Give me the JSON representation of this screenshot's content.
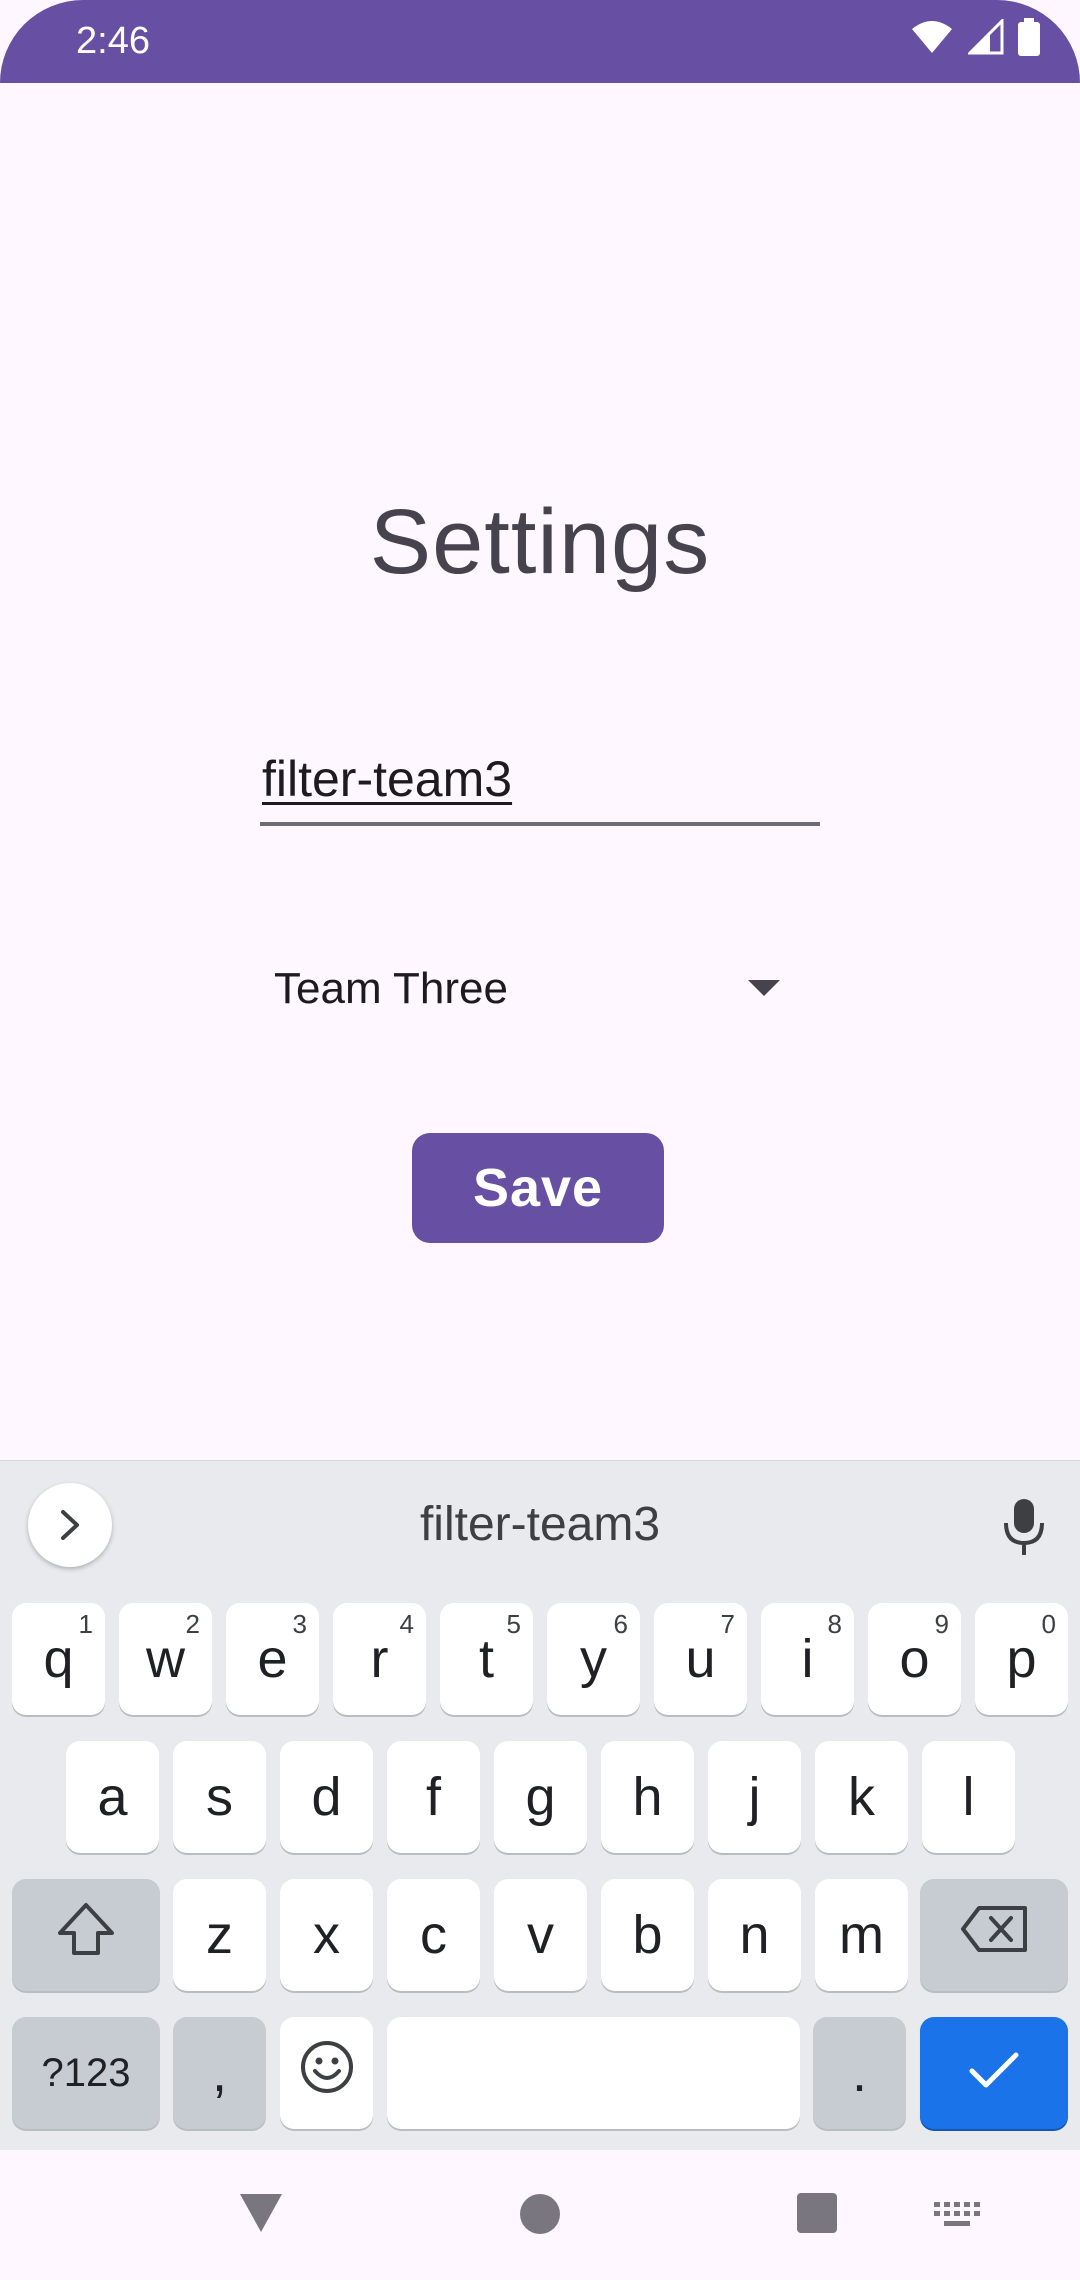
{
  "status_bar": {
    "time": "2:46",
    "icons": [
      "wifi-icon",
      "signal-icon",
      "battery-icon"
    ],
    "color": "#6750a4"
  },
  "screen": {
    "title": "Settings",
    "filter_field": {
      "value": "filter-team3"
    },
    "team_dropdown": {
      "selected": "Team Three",
      "icon": "dropdown-arrow-icon"
    },
    "save_label": "Save",
    "accent_color": "#6750a4"
  },
  "keyboard": {
    "suggestion": "filter-team3",
    "expand_icon": "chevron-right-icon",
    "mic_icon": "mic-icon",
    "row1": [
      {
        "k": "q",
        "h": "1"
      },
      {
        "k": "w",
        "h": "2"
      },
      {
        "k": "e",
        "h": "3"
      },
      {
        "k": "r",
        "h": "4"
      },
      {
        "k": "t",
        "h": "5"
      },
      {
        "k": "y",
        "h": "6"
      },
      {
        "k": "u",
        "h": "7"
      },
      {
        "k": "i",
        "h": "8"
      },
      {
        "k": "o",
        "h": "9"
      },
      {
        "k": "p",
        "h": "0"
      }
    ],
    "row2": [
      "a",
      "s",
      "d",
      "f",
      "g",
      "h",
      "j",
      "k",
      "l"
    ],
    "row3": [
      "z",
      "x",
      "c",
      "v",
      "b",
      "n",
      "m"
    ],
    "symbols_label": "?123",
    "comma_label": ",",
    "period_label": ".",
    "shift_icon": "shift-icon",
    "backspace_icon": "backspace-icon",
    "emoji_icon": "emoji-icon",
    "enter_icon": "checkmark-icon",
    "enter_color": "#1a73e8"
  },
  "nav_bar": {
    "items": [
      "back-icon",
      "home-icon",
      "recents-icon",
      "keyboard-switch-icon"
    ]
  }
}
